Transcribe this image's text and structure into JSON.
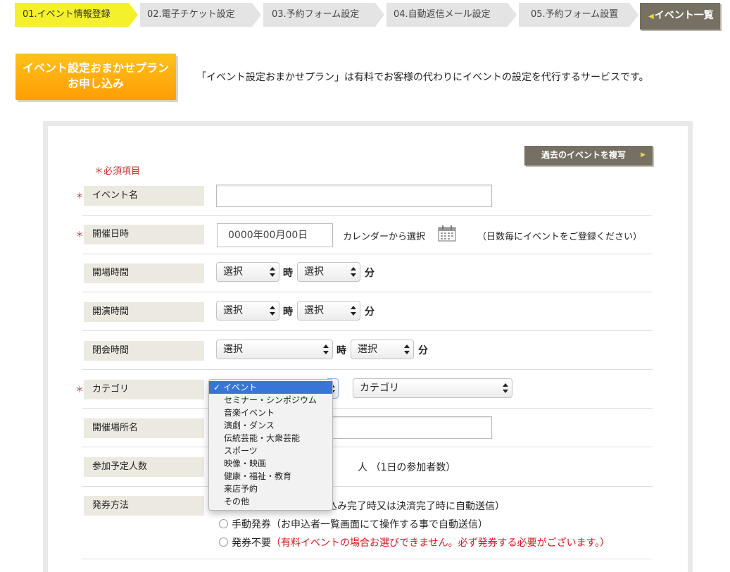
{
  "steps": [
    {
      "label": "01.イベント情報登録"
    },
    {
      "label": "02.電子チケット設定"
    },
    {
      "label": "03.予約フォーム設定"
    },
    {
      "label": "04.自動返信メール設定"
    },
    {
      "label": "05.予約フォーム設置"
    }
  ],
  "event_list_button": "イベント一覧",
  "plan": {
    "button_line1": "イベント設定おまかせプラン",
    "button_line2": "お申し込み",
    "description": "「イベント設定おまかせプラン」は有料でお客様の代わりにイベントの設定を代行するサービスです。"
  },
  "form": {
    "copy_button": "過去のイベントを複写",
    "required_note": "＊必須項目",
    "star": "＊",
    "event_name": {
      "label": "イベント名",
      "value": ""
    },
    "date": {
      "label": "開催日時",
      "value": "0000年00月00日",
      "calendar_text": "カレンダーから選択",
      "note": "（日数毎にイベントをご登録ください）"
    },
    "open_time": {
      "label": "開場時間",
      "hour": "選択",
      "minute": "選択",
      "hour_unit": "時",
      "minute_unit": "分"
    },
    "start_time": {
      "label": "開演時間",
      "hour": "選択",
      "minute": "選択",
      "hour_unit": "時",
      "minute_unit": "分"
    },
    "close_time": {
      "label": "閉会時間",
      "hour": "選択",
      "minute": "選択",
      "hour_unit": "時",
      "minute_unit": "分"
    },
    "category": {
      "label": "カテゴリ",
      "second_select": "カテゴリ",
      "options": [
        "イベント",
        "セミナー・シンポジウム",
        "音楽イベント",
        "演劇・ダンス",
        "伝統芸能・大衆芸能",
        "スポーツ",
        "映像・映画",
        "健康・福祉・教育",
        "来店予約",
        "その他"
      ],
      "selected": "イベント"
    },
    "venue": {
      "label": "開催場所名",
      "value": ""
    },
    "attendance": {
      "label": "参加予定人数",
      "suffix": "人 （1日の参加者数）"
    },
    "ticketing": {
      "label": "発券方法",
      "option1_tail": "込み完了時又は決済完了時に自動送信）",
      "option2": "手動発券（お申込者一覧画面にて操作する事で自動送信）",
      "option3_main": "発券不要",
      "option3_note": "（有料イベントの場合お選びできません。必ず発券する必要がございます。）"
    }
  },
  "colors": {
    "active_step": "#f4f02c",
    "step": "#e4e4e4",
    "dark_button": "#767063",
    "plan_orange": "#ffa50c",
    "required_red": "#c33",
    "label_bg": "#ece9e1",
    "dropdown_highlight": "#3875d7"
  }
}
